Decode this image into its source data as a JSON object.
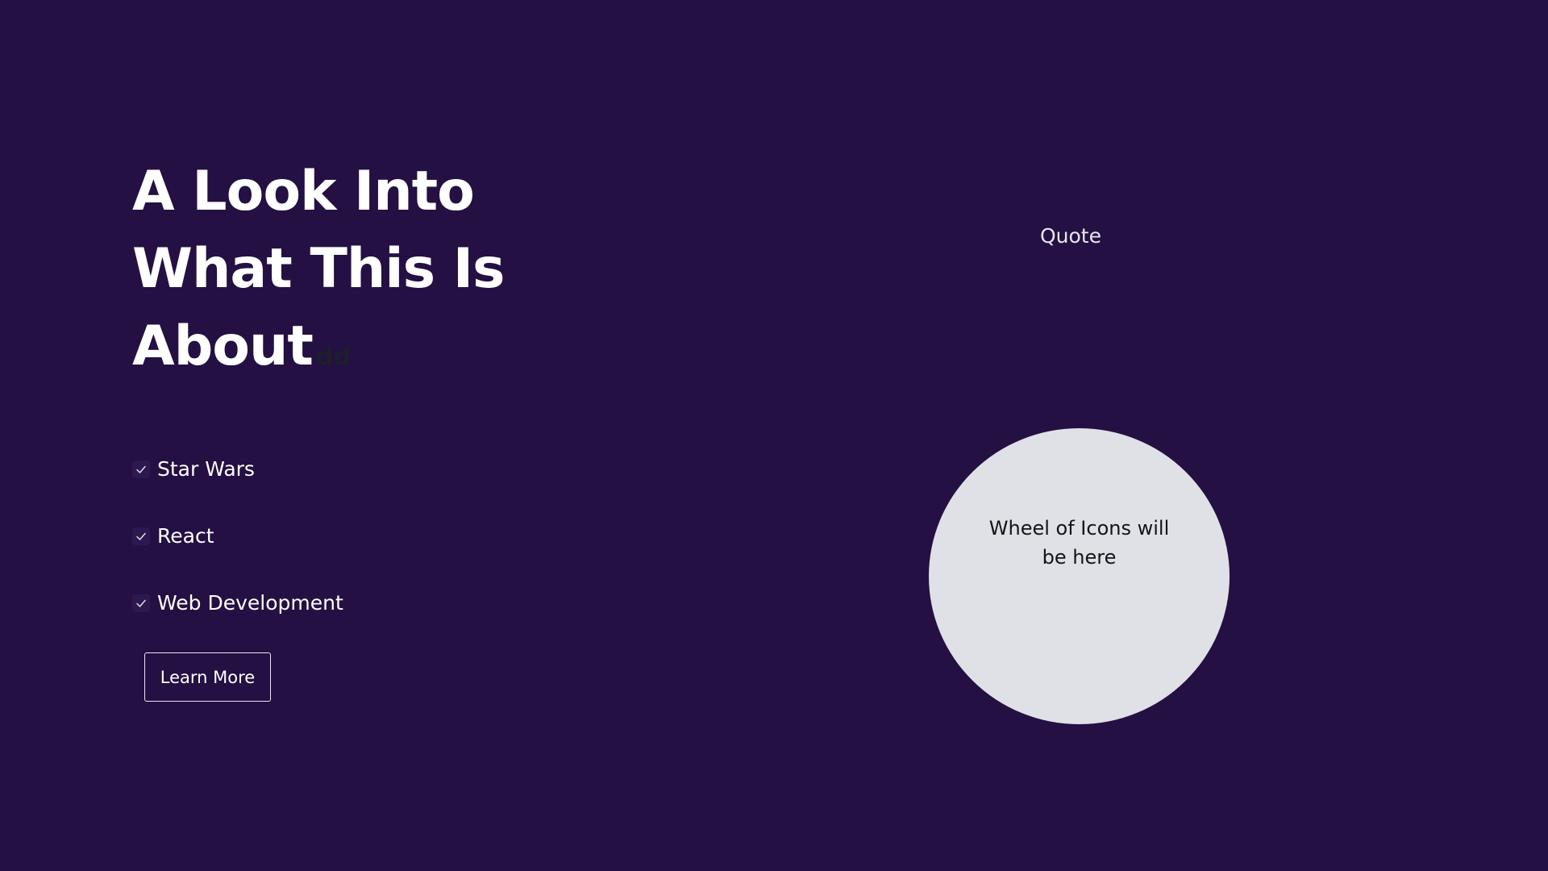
{
  "hero": {
    "heading_lines": [
      "A Look Into",
      "What This Is",
      "About"
    ],
    "heading_ghost_text": "dd"
  },
  "checklist": {
    "items": [
      {
        "label": "Star Wars",
        "icon": "check-icon"
      },
      {
        "label": "React",
        "icon": "check-icon"
      },
      {
        "label": "Web Development",
        "icon": "check-icon"
      }
    ]
  },
  "cta": {
    "learn_more_label": "Learn More"
  },
  "side": {
    "quote_label": "Quote",
    "wheel_placeholder": "Wheel of Icons will be here"
  },
  "colors": {
    "background": "#241043",
    "text": "#ffffff",
    "wheel": "#dfe1e6",
    "wheel_text": "#141418"
  }
}
